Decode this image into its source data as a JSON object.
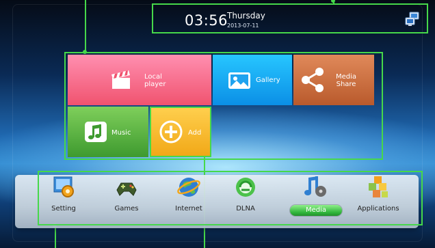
{
  "status": {
    "time": "03:56",
    "day": "Thursday",
    "date": "2013-07-11"
  },
  "tiles": {
    "local_player": {
      "line1": "Local",
      "line2": "player"
    },
    "gallery": {
      "label": "Gallery"
    },
    "media_share": {
      "line1": "Media",
      "line2": "Share"
    },
    "music": {
      "label": "Music"
    },
    "add": {
      "label": "Add"
    }
  },
  "dock": {
    "setting": "Setting",
    "games": "Games",
    "internet": "Internet",
    "dlna": "DLNA",
    "media": "Media",
    "applications": "Applications"
  },
  "colors": {
    "focus_outline": "#46d84a",
    "local_player_tile": "#f0536f",
    "gallery_tile": "#0b8fe6",
    "media_share_tile": "#b95a2c",
    "music_tile": "#3e9a2f",
    "add_tile": "#f1a716"
  },
  "icons": {
    "network": "network-computer-icon",
    "local_player": "clapperboard-icon",
    "gallery": "picture-icon",
    "media_share": "share-icon",
    "music": "music-note-icon",
    "add": "plus-circle-icon",
    "setting": "gear-icon",
    "games": "gamepad-icon",
    "internet": "globe-icon",
    "dlna": "dlna-icon",
    "media": "media-icon",
    "applications": "apps-grid-icon"
  }
}
